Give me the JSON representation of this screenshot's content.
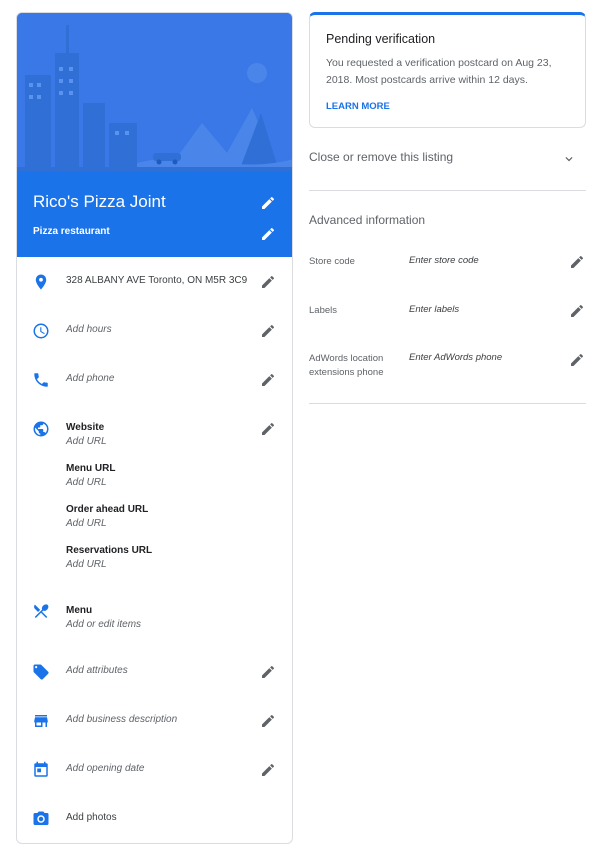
{
  "business": {
    "name": "Rico's Pizza Joint",
    "category": "Pizza restaurant"
  },
  "info": {
    "address": "328 ALBANY AVE Toronto, ON M5R 3C9",
    "hours": "Add hours",
    "phone": "Add phone",
    "website_label": "Website",
    "website_value": "Add URL",
    "menu_url_label": "Menu URL",
    "menu_url_value": "Add URL",
    "order_url_label": "Order ahead URL",
    "order_url_value": "Add URL",
    "reservations_url_label": "Reservations URL",
    "reservations_url_value": "Add URL",
    "menu_label": "Menu",
    "menu_value": "Add or edit items",
    "attributes": "Add attributes",
    "description": "Add business description",
    "opening_date": "Add opening date",
    "photos": "Add photos"
  },
  "pending": {
    "title": "Pending verification",
    "body": "You requested a verification postcard on Aug 23, 2018. Most postcards arrive within 12 days.",
    "learn_more": "LEARN MORE"
  },
  "close_listing": "Close or remove this listing",
  "advanced": {
    "title": "Advanced information",
    "store_code_label": "Store code",
    "store_code_value": "Enter store code",
    "labels_label": "Labels",
    "labels_value": "Enter labels",
    "adwords_label": "AdWords location extensions phone",
    "adwords_value": "Enter AdWords phone"
  },
  "colors": {
    "accent": "#1a73e8",
    "hero": "#3b78e7",
    "icon_grey": "#5f6368"
  }
}
